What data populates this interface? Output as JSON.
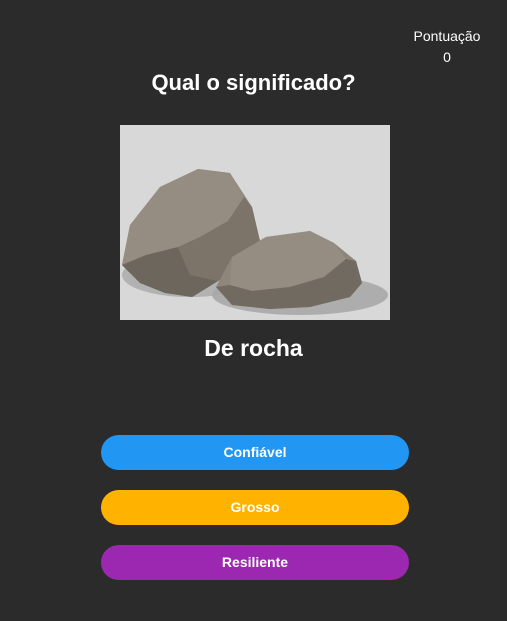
{
  "score": {
    "label": "Pontuação",
    "value": "0"
  },
  "question": {
    "title": "Qual o significado?",
    "word": "De rocha",
    "image_icon": "rocks-illustration"
  },
  "options": [
    {
      "label": "Confiável",
      "color": "#2196f3"
    },
    {
      "label": "Grosso",
      "color": "#ffb300"
    },
    {
      "label": "Resiliente",
      "color": "#9c27b0"
    }
  ],
  "colors": {
    "background": "#2b2b2b",
    "image_background": "#d8d8d8",
    "text": "#ffffff"
  }
}
